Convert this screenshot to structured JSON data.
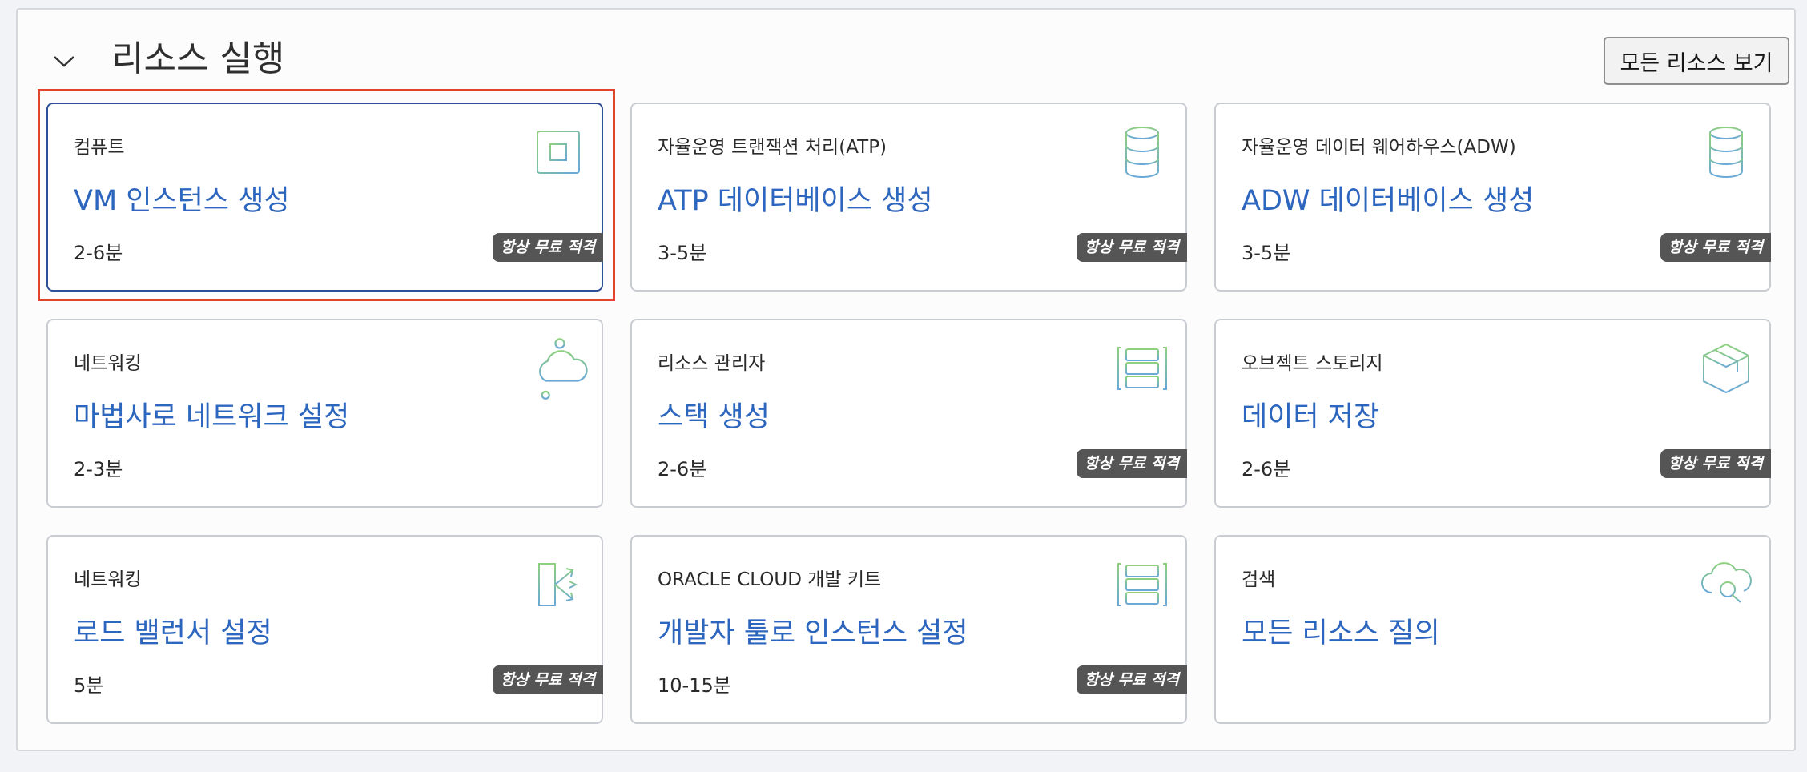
{
  "header": {
    "title": "리소스 실행",
    "view_all_label": "모든 리소스 보기"
  },
  "cards": [
    {
      "category": "컴퓨트",
      "title": "VM 인스턴스 생성",
      "time": "2-6분",
      "badge": "항상 무료 적격",
      "icon": "chip-icon"
    },
    {
      "category": "자율운영 트랜잭션 처리(ATP)",
      "title": "ATP 데이터베이스 생성",
      "time": "3-5분",
      "badge": "항상 무료 적격",
      "icon": "database-icon"
    },
    {
      "category": "자율운영 데이터 웨어하우스(ADW)",
      "title": "ADW 데이터베이스 생성",
      "time": "3-5분",
      "badge": "항상 무료 적격",
      "icon": "database-icon"
    },
    {
      "category": "네트워킹",
      "title": "마법사로 네트워크 설정",
      "time": "2-3분",
      "badge": "",
      "icon": "cloud-network-icon"
    },
    {
      "category": "리소스 관리자",
      "title": "스택 생성",
      "time": "2-6분",
      "badge": "항상 무료 적격",
      "icon": "stack-icon"
    },
    {
      "category": "오브젝트 스토리지",
      "title": "데이터 저장",
      "time": "2-6분",
      "badge": "항상 무료 적격",
      "icon": "box-icon"
    },
    {
      "category": "네트워킹",
      "title": "로드 밸런서 설정",
      "time": "5분",
      "badge": "항상 무료 적격",
      "icon": "load-balancer-icon"
    },
    {
      "category": "ORACLE CLOUD 개발 키트",
      "title": "개발자 툴로 인스턴스 설정",
      "time": "10-15분",
      "badge": "항상 무료 적격",
      "icon": "stack-icon"
    },
    {
      "category": "검색",
      "title": "모든 리소스 질의",
      "time": "",
      "badge": "",
      "icon": "cloud-search-icon"
    }
  ],
  "colors": {
    "link": "#2d66bf",
    "badge_bg": "#555555",
    "highlight": "#e2432d",
    "icon_green": "#8fd07f",
    "icon_blue": "#6aa8d8"
  }
}
